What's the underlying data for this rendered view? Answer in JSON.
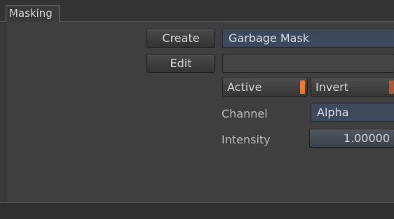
{
  "tabs": [
    {
      "label": "Masking",
      "active": true
    }
  ],
  "masking": {
    "create_label": "Create",
    "mask_type": "Garbage Mask",
    "edit_label": "Edit",
    "edit_value": "",
    "active_label": "Active",
    "active_on": true,
    "invert_label": "Invert",
    "invert_on": false,
    "channel_label": "Channel",
    "channel_value": "Alpha",
    "intensity_label": "Intensity",
    "intensity_value": "1.00000"
  },
  "colors": {
    "toggle_on": "#f07830",
    "toggle_off": "#b0582a",
    "field_blue": "#3e4a5c"
  }
}
